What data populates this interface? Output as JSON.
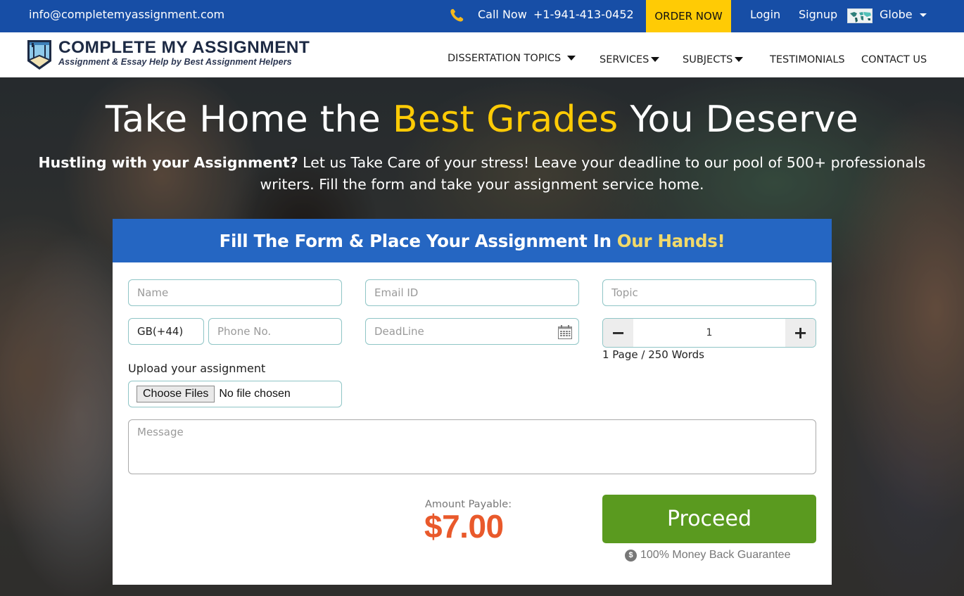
{
  "topbar": {
    "email": "info@completemyassignment.com",
    "call_label": "Call Now",
    "call_number": "+1-941-413-0452",
    "order_now": "ORDER NOW",
    "login": "Login",
    "signup": "Signup",
    "globe": "Globe"
  },
  "brand": {
    "title": "COMPLETE MY ASSIGNMENT",
    "tagline": "Assignment & Essay Help by Best Assignment Helpers"
  },
  "nav": {
    "items": [
      {
        "label": "DISSERTATION TOPICS",
        "dropdown": true
      },
      {
        "label": "SERVICES",
        "dropdown": true
      },
      {
        "label": "SUBJECTS",
        "dropdown": true
      },
      {
        "label": "TESTIMONIALS",
        "dropdown": false
      },
      {
        "label": "CONTACT US",
        "dropdown": false
      }
    ]
  },
  "hero": {
    "title_pre": "Take Home the ",
    "title_accent": "Best Grades",
    "title_post": " You Deserve",
    "sub_strong": "Hustling with your Assignment?",
    "sub_rest": " Let us Take Care of your stress! Leave your deadline to our pool of 500+ professionals writers. Fill the form and take your assignment service home."
  },
  "form": {
    "heading_pre": "Fill The Form & Place Your Assignment In",
    "heading_accent": "Our Hands!",
    "name_placeholder": "Name",
    "email_placeholder": "Email ID",
    "topic_placeholder": "Topic",
    "country_code": "GB(+44)",
    "phone_placeholder": "Phone No.",
    "deadline_placeholder": "DeadLine",
    "pages_value": "1",
    "minus": "−",
    "plus": "+",
    "pages_note": "1 Page / 250 Words",
    "upload_label": "Upload your assignment",
    "choose_files": "Choose Files",
    "file_status": "No file chosen",
    "message_placeholder": "Message",
    "amount_label": "Amount Payable:",
    "amount_value": "$7.00",
    "proceed": "Proceed",
    "guarantee_icon": "$",
    "guarantee": "100% Money Back Guarantee"
  },
  "colors": {
    "topbar": "#174ea6",
    "order_now": "#ffcb05",
    "accent_yellow": "#ffcb05",
    "form_header": "#2566c2",
    "proceed_green": "#5a9a1f",
    "amount_orange": "#e9592b"
  }
}
